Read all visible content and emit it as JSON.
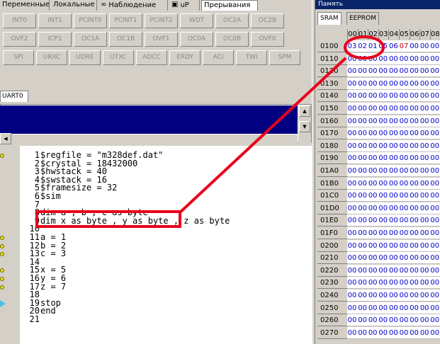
{
  "tabs": [
    {
      "label": "Переменные",
      "icon": "variables-icon"
    },
    {
      "label": "Локальные",
      "icon": "locals-icon"
    },
    {
      "label": "Наблюдение",
      "icon": "glasses-icon"
    },
    {
      "label": "uP",
      "icon": "chip-icon"
    },
    {
      "label": "Прерывания",
      "icon": "interrupts-icon"
    }
  ],
  "interrupts": [
    [
      "INT0",
      "INT1",
      "PCINT0",
      "PCINT1",
      "PCINT2",
      "WDT",
      "OC2A",
      "OC2B"
    ],
    [
      "OVF2",
      "ICP1",
      "OC1A",
      "OC1B",
      "OVF1",
      "OC0A",
      "OC0B",
      "OVF0"
    ],
    [
      "SPI",
      "URXC",
      "UDRE",
      "UTXC",
      "ADCC",
      "ERDY",
      "ACI",
      "TWI",
      "SPM"
    ]
  ],
  "uart": {
    "tab_label": "UART0"
  },
  "editor": {
    "lines": [
      {
        "n": "1",
        "code": "$regfile = \"m328def.dat\"",
        "dot": true
      },
      {
        "n": "2",
        "code": "$crystal = 18432000",
        "dot": false
      },
      {
        "n": "3",
        "code": "$hwstack = 40",
        "dot": false
      },
      {
        "n": "4",
        "code": "$swstack = 16",
        "dot": false
      },
      {
        "n": "5",
        "code": "$framesize = 32",
        "dot": false
      },
      {
        "n": "6",
        "code": "$sim",
        "dot": false
      },
      {
        "n": "7",
        "code": "",
        "dot": false
      },
      {
        "n": "8",
        "code": "dim a , b , c as byte",
        "dot": false
      },
      {
        "n": "9",
        "code": "dim x as byte , y as byte , z as byte",
        "dot": false
      },
      {
        "n": "10",
        "code": "",
        "dot": false
      },
      {
        "n": "11",
        "code": "a = 1",
        "dot": true
      },
      {
        "n": "12",
        "code": "b = 2",
        "dot": true
      },
      {
        "n": "13",
        "code": "c = 3",
        "dot": true
      },
      {
        "n": "14",
        "code": "",
        "dot": false
      },
      {
        "n": "15",
        "code": "x = 5",
        "dot": true
      },
      {
        "n": "16",
        "code": "y = 6",
        "dot": true
      },
      {
        "n": "17",
        "code": "z = 7",
        "dot": true
      },
      {
        "n": "18",
        "code": "",
        "dot": false
      },
      {
        "n": "19",
        "code": "stop",
        "arrow": true
      },
      {
        "n": "20",
        "code": "end",
        "dot": false
      },
      {
        "n": "21",
        "code": "",
        "dot": false
      }
    ]
  },
  "memory": {
    "title": "Память",
    "tabs": [
      "SRAM",
      "EEPROM"
    ],
    "columns": [
      "00",
      "01",
      "02",
      "03",
      "04",
      "05",
      "06",
      "07",
      "08"
    ],
    "first_row": {
      "addr": "0100",
      "values": [
        "03",
        "02",
        "01",
        "05",
        "06",
        "07",
        "00",
        "00",
        "00"
      ],
      "red_index": 5
    },
    "addresses": [
      "0100",
      "0110",
      "0120",
      "0130",
      "0140",
      "0150",
      "0160",
      "0170",
      "0180",
      "0190",
      "01A0",
      "01B0",
      "01C0",
      "01D0",
      "01E0",
      "01F0",
      "0200",
      "0210",
      "0220",
      "0230",
      "0240",
      "0250",
      "0260",
      "0270"
    ],
    "fill": "00"
  },
  "annotation": {
    "color": "#e8001c"
  }
}
